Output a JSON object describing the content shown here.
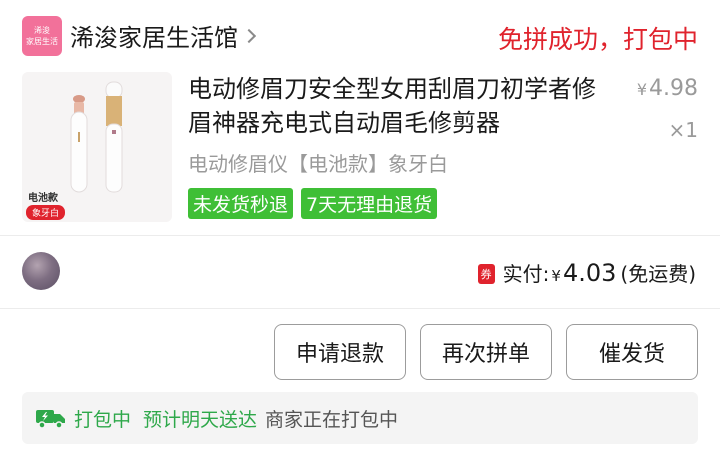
{
  "shop": {
    "logo_line1": "浠浚",
    "logo_line2": "家居生活",
    "name": "浠浚家居生活馆",
    "order_status": "免拼成功，打包中"
  },
  "product": {
    "title": "电动修眉刀安全型女用刮眉刀初学者修眉神器充电式自动眉毛修剪器",
    "price_symbol": "¥",
    "price": "4.98",
    "quantity": "×1",
    "spec": "电动修眉仪【电池款】象牙白",
    "image_tag": "电池款",
    "image_badge": "象牙白",
    "service_tags": [
      "未发货秒退",
      "7天无理由退货"
    ]
  },
  "payment": {
    "coupon_icon": "券",
    "paid_label": "实付:",
    "currency": "¥",
    "amount": "4.03",
    "shipping_note": "(免运费)"
  },
  "actions": {
    "refund": "申请退款",
    "regroup": "再次拼单",
    "urge": "催发货"
  },
  "logistics": {
    "icon": "truck-fast-icon",
    "stage": "打包中",
    "eta": "预计明天送达",
    "description": "商家正在打包中"
  },
  "colors": {
    "status_red": "#e0232d",
    "tag_green": "#3fbf36",
    "logistics_green": "#2ea84a",
    "logo_pink": "#f2719a"
  }
}
